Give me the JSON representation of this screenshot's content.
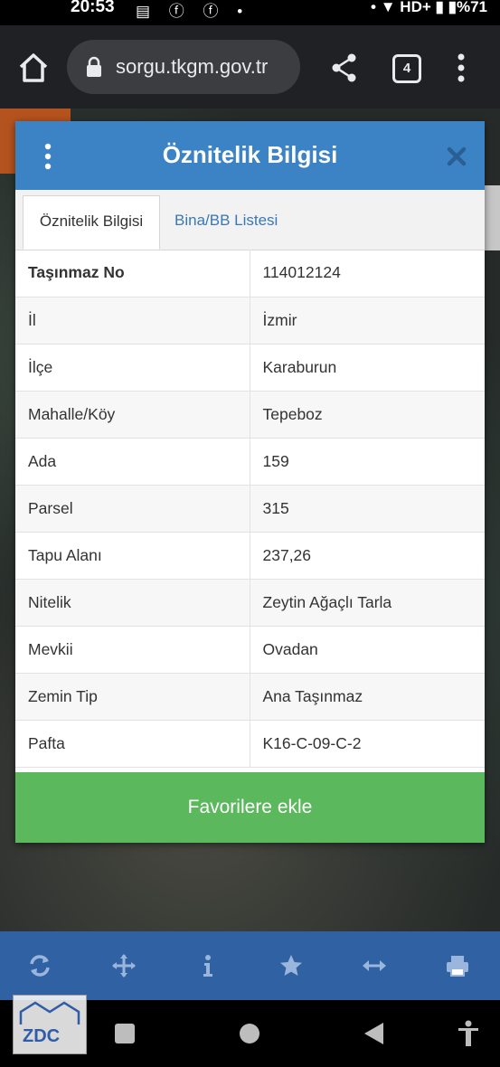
{
  "status_bar": {
    "time": "20:53",
    "network": "HD+",
    "battery": "%71"
  },
  "browser": {
    "url": "sorgu.tkgm.gov.tr",
    "tab_count": "4"
  },
  "dialog": {
    "title": "Öznitelik Bilgisi",
    "tabs": [
      {
        "label": "Öznitelik Bilgisi",
        "active": true
      },
      {
        "label": "Bina/BB Listesi",
        "active": false
      }
    ],
    "rows": [
      {
        "key": "Taşınmaz No",
        "value": "114012124"
      },
      {
        "key": "İl",
        "value": "İzmir"
      },
      {
        "key": "İlçe",
        "value": "Karaburun"
      },
      {
        "key": "Mahalle/Köy",
        "value": "Tepeboz"
      },
      {
        "key": "Ada",
        "value": "159"
      },
      {
        "key": "Parsel",
        "value": "315"
      },
      {
        "key": "Tapu Alanı",
        "value": "237,26"
      },
      {
        "key": "Nitelik",
        "value": "Zeytin Ağaçlı Tarla"
      },
      {
        "key": "Mevkii",
        "value": "Ovadan"
      },
      {
        "key": "Zemin Tip",
        "value": "Ana Taşınmaz"
      },
      {
        "key": "Pafta",
        "value": "K16-C-09-C-2"
      }
    ],
    "favorite_button": "Favorilere ekle"
  },
  "watermark": {
    "text": "ZDC"
  },
  "colors": {
    "header_blue": "#3c83c6",
    "toolbar_blue": "#2f61a3",
    "favorite_green": "#5cb85c",
    "tab_link_blue": "#3a78b5"
  },
  "icons": {
    "map_toolbar": [
      "refresh-icon",
      "crosshair-icon",
      "info-icon",
      "star-icon",
      "arrows-horizontal-icon",
      "print-icon"
    ]
  }
}
